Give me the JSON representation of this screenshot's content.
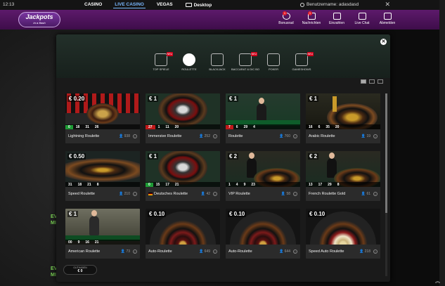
{
  "topbar": {
    "time": "12:13",
    "nav": [
      "CASINO",
      "LIVE CASINO",
      "VEGAS"
    ],
    "active_nav": "LIVE CASINO",
    "desktop_label": "Desktop",
    "user_label": "Benutzername: adasdasd",
    "close_symbol": "✕"
  },
  "header": {
    "logo_main": "Jackpots",
    "logo_sub": "in a flash",
    "nav": [
      {
        "label": "Bonusrad",
        "icon": "wheel-icon",
        "badge": "1"
      },
      {
        "label": "Nachrichten",
        "icon": "mail-icon",
        "badge": "1"
      },
      {
        "label": "Einzahlen",
        "icon": "deposit-icon",
        "badge": ""
      },
      {
        "label": "Live Chat",
        "icon": "chat-icon",
        "badge": ""
      },
      {
        "label": "Abmelden",
        "icon": "logout-icon",
        "badge": ""
      }
    ]
  },
  "background_text": [
    "EV",
    "MI",
    "EV",
    "MI"
  ],
  "modal": {
    "close_symbol": "✕",
    "categories": [
      {
        "label": "TOP SPIELE",
        "neu": "NEU"
      },
      {
        "label": "ROULETTE",
        "neu": ""
      },
      {
        "label": "BLACKJACK",
        "neu": ""
      },
      {
        "label": "BACCARAT & DIC BO",
        "neu": "NEU"
      },
      {
        "label": "POKER",
        "neu": ""
      },
      {
        "label": "GAMESHOWS",
        "neu": "NEU"
      }
    ],
    "active_category": "ROULETTE",
    "games": [
      {
        "name": "Lightning Roulette",
        "stake": "€ 0.20",
        "players": "938",
        "results": [
          "0",
          "18",
          "31",
          "26"
        ],
        "result_colors": [
          "green",
          "",
          "",
          ""
        ],
        "flag": false,
        "style": "lightning"
      },
      {
        "name": "Immersive Roulette",
        "stake": "€ 1",
        "players": "252",
        "results": [
          "27",
          "1",
          "11",
          "20"
        ],
        "result_colors": [
          "red",
          "",
          "",
          ""
        ],
        "flag": false,
        "style": "immersive"
      },
      {
        "name": "Roulette",
        "stake": "€ 1",
        "players": "760",
        "results": [
          "7",
          "6",
          "29",
          "4"
        ],
        "result_colors": [
          "red",
          "",
          "",
          ""
        ],
        "flag": false,
        "style": "dealer"
      },
      {
        "name": "Arabic Roulette",
        "stake": "€ 1",
        "players": "19",
        "results": [
          "16",
          "6",
          "35",
          "20"
        ],
        "result_colors": [
          "",
          "",
          "",
          ""
        ],
        "flag": false,
        "style": "arabic"
      },
      {
        "name": "Speed Roulette",
        "stake": "€ 0.50",
        "players": "210",
        "results": [
          "31",
          "18",
          "21",
          "8"
        ],
        "result_colors": [
          "",
          "",
          "",
          ""
        ],
        "flag": false,
        "style": "speed"
      },
      {
        "name": "Deutsches Roulette",
        "stake": "€ 1",
        "players": "42",
        "results": [
          "0",
          "15",
          "17",
          "21"
        ],
        "result_colors": [
          "green",
          "",
          "",
          ""
        ],
        "flag": true,
        "style": "immersive"
      },
      {
        "name": "VIP Roulette",
        "stake": "€ 2",
        "players": "58",
        "results": [
          "1",
          "4",
          "9",
          "23"
        ],
        "result_colors": [
          "",
          "",
          "",
          ""
        ],
        "flag": false,
        "style": "vip"
      },
      {
        "name": "French Roulette Gold",
        "stake": "€ 2",
        "players": "61",
        "results": [
          "13",
          "17",
          "29",
          "8"
        ],
        "result_colors": [
          "",
          "",
          "",
          ""
        ],
        "flag": false,
        "style": "vip"
      },
      {
        "name": "American Roulette",
        "stake": "€ 1",
        "players": "73",
        "results": [
          "00",
          "9",
          "16",
          "21"
        ],
        "result_colors": [
          "",
          "",
          "",
          ""
        ],
        "flag": false,
        "style": "american"
      },
      {
        "name": "Auto-Roulette",
        "stake": "€ 0.10",
        "players": "649",
        "results": [
          "",
          "",
          "",
          ""
        ],
        "result_colors": [
          "",
          "",
          "",
          ""
        ],
        "flag": false,
        "style": "auto"
      },
      {
        "name": "Auto-Roulette",
        "stake": "€ 0.10",
        "players": "644",
        "results": [
          "",
          "",
          "",
          ""
        ],
        "result_colors": [
          "",
          "",
          "",
          ""
        ],
        "flag": false,
        "style": "auto"
      },
      {
        "name": "Speed Auto Roulette",
        "stake": "€ 0.10",
        "players": "218",
        "results": [
          "",
          "",
          "",
          ""
        ],
        "result_colors": [
          "",
          "",
          "",
          ""
        ],
        "flag": false,
        "style": "speedauto"
      }
    ]
  },
  "balance": {
    "label": "GUTHABEN",
    "value": "€ 0"
  },
  "scroll_up_symbol": "︽"
}
